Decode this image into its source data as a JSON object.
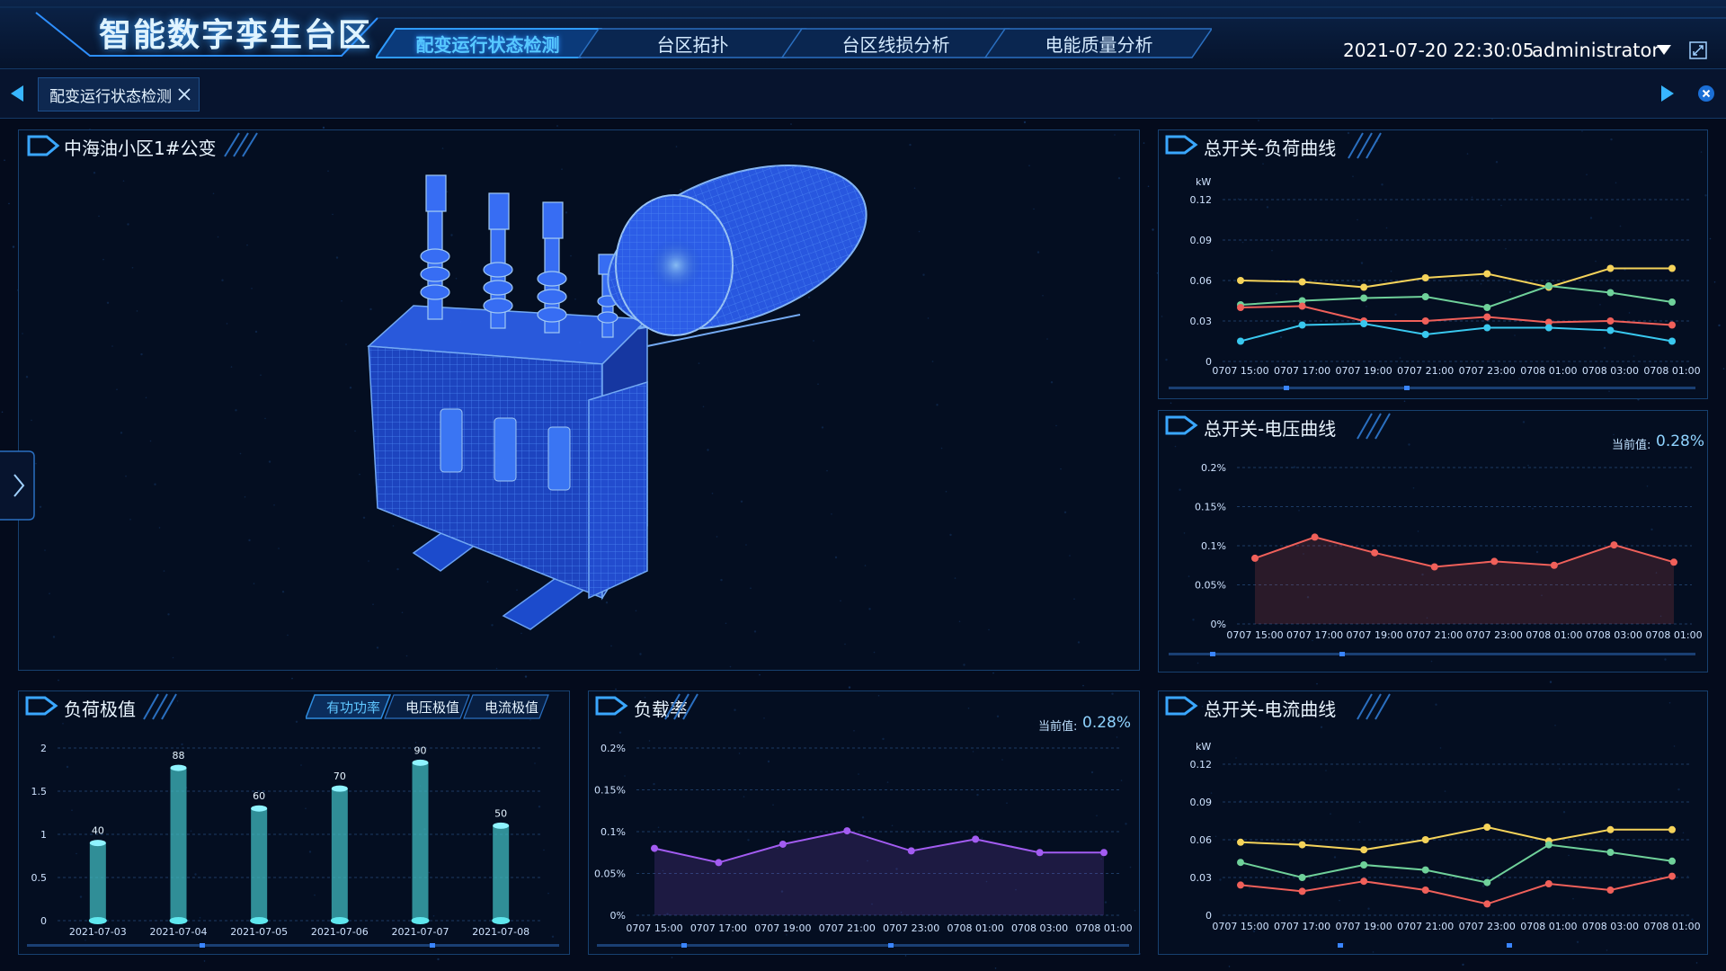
{
  "header": {
    "title": "智能数字孪生台区",
    "tabs": [
      {
        "label": "配变运行状态检测",
        "active": true
      },
      {
        "label": "台区拓扑",
        "active": false
      },
      {
        "label": "台区线损分析",
        "active": false
      },
      {
        "label": "电能质量分析",
        "active": false
      }
    ],
    "datetime": "2021-07-20  22:30:05",
    "username": "administrator"
  },
  "tabbar": {
    "open_tab": "配变运行状态检测"
  },
  "main_panel": {
    "title": "中海油小区1#公变"
  },
  "panels": {
    "load_curve": {
      "title": "总开关-负荷曲线"
    },
    "voltage_curve": {
      "title": "总开关-电压曲线",
      "current_label": "当前值:",
      "current_value": "0.28%"
    },
    "load_extreme": {
      "title": "负荷极值",
      "tabs": [
        "有功功率",
        "电压极值",
        "电流极值"
      ],
      "active_tab": 0
    },
    "load_rate": {
      "title": "负载率",
      "current_label": "当前值:",
      "current_value": "0.28%"
    },
    "current_curve": {
      "title": "总开关-电流曲线"
    }
  },
  "colors": {
    "yellow": "#f5d35a",
    "green": "#6fd19a",
    "red": "#f0605a",
    "cyan": "#39c8ef",
    "purple": "#a35cf2",
    "bar": "#3fb9bf",
    "accent": "#2e8fff"
  },
  "chart_data": [
    {
      "id": "load_curve",
      "type": "line",
      "ylabel": "kW",
      "yticks": [
        "0",
        "0.03",
        "0.06",
        "0.09",
        "0.12"
      ],
      "ylim": [
        0,
        0.12
      ],
      "categories": [
        "0707 15:00",
        "0707 17:00",
        "0707 19:00",
        "0707 21:00",
        "0707 23:00",
        "0708 01:00",
        "0708 03:00",
        "0708 01:00"
      ],
      "series": [
        {
          "color": "yellow",
          "values": [
            0.06,
            0.059,
            0.055,
            0.062,
            0.065,
            0.055,
            0.069,
            0.069
          ]
        },
        {
          "color": "green",
          "values": [
            0.042,
            0.045,
            0.047,
            0.048,
            0.04,
            0.056,
            0.051,
            0.044
          ]
        },
        {
          "color": "red",
          "values": [
            0.04,
            0.041,
            0.03,
            0.03,
            0.033,
            0.029,
            0.03,
            0.027
          ]
        },
        {
          "color": "cyan",
          "values": [
            0.015,
            0.027,
            0.028,
            0.02,
            0.025,
            0.025,
            0.023,
            0.015
          ]
        }
      ]
    },
    {
      "id": "voltage_curve",
      "type": "area",
      "yticks": [
        "0%",
        "0.05%",
        "0.1%",
        "0.15%",
        "0.2%"
      ],
      "ylim": [
        0,
        0.2
      ],
      "categories": [
        "0707 15:00",
        "0707 17:00",
        "0707 19:00",
        "0707 21:00",
        "0707 23:00",
        "0708 01:00",
        "0708 03:00",
        "0708 01:00"
      ],
      "series": [
        {
          "color": "red",
          "values": [
            0.084,
            0.111,
            0.091,
            0.073,
            0.08,
            0.075,
            0.101,
            0.079
          ]
        }
      ]
    },
    {
      "id": "load_extreme",
      "type": "bar",
      "yticks": [
        "0",
        "0.5",
        "1",
        "1.5",
        "2"
      ],
      "ylim": [
        0,
        2
      ],
      "categories": [
        "2021-07-03",
        "2021-07-04",
        "2021-07-05",
        "2021-07-06",
        "2021-07-07",
        "2021-07-08"
      ],
      "values": [
        0.9,
        1.77,
        1.3,
        1.53,
        1.83,
        1.1
      ],
      "labels": [
        "40",
        "88",
        "60",
        "70",
        "90",
        "50"
      ]
    },
    {
      "id": "load_rate",
      "type": "area",
      "yticks": [
        "0%",
        "0.05%",
        "0.1%",
        "0.15%",
        "0.2%"
      ],
      "ylim": [
        0,
        0.2
      ],
      "categories": [
        "0707 15:00",
        "0707 17:00",
        "0707 19:00",
        "0707 21:00",
        "0707 23:00",
        "0708 01:00",
        "0708 03:00",
        "0708 01:00"
      ],
      "series": [
        {
          "color": "purple",
          "values": [
            0.08,
            0.063,
            0.085,
            0.101,
            0.077,
            0.091,
            0.075,
            0.075
          ]
        }
      ]
    },
    {
      "id": "current_curve",
      "type": "line",
      "ylabel": "kW",
      "yticks": [
        "0",
        "0.03",
        "0.06",
        "0.09",
        "0.12"
      ],
      "ylim": [
        0,
        0.12
      ],
      "categories": [
        "0707 15:00",
        "0707 17:00",
        "0707 19:00",
        "0707 21:00",
        "0707 23:00",
        "0708 01:00",
        "0708 03:00",
        "0708 01:00"
      ],
      "series": [
        {
          "color": "yellow",
          "values": [
            0.058,
            0.056,
            0.052,
            0.06,
            0.07,
            0.059,
            0.068,
            0.068
          ]
        },
        {
          "color": "green",
          "values": [
            0.042,
            0.03,
            0.04,
            0.036,
            0.026,
            0.056,
            0.05,
            0.043
          ]
        },
        {
          "color": "red",
          "values": [
            0.024,
            0.019,
            0.027,
            0.02,
            0.009,
            0.025,
            0.02,
            0.031
          ]
        }
      ]
    }
  ]
}
